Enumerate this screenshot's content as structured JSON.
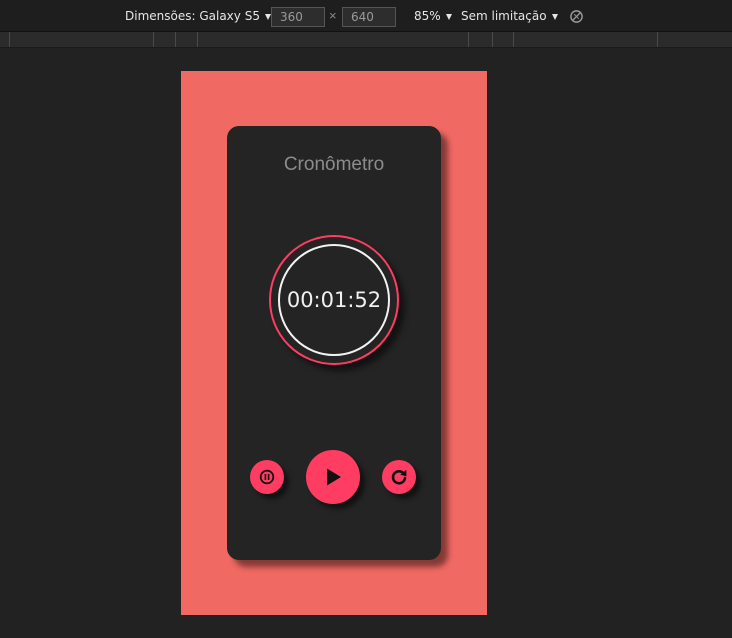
{
  "toolbar": {
    "dimensions_label": "Dimensões: Galaxy S5",
    "width_value": "360",
    "height_value": "640",
    "times_symbol": "×",
    "zoom": "85%",
    "throttle": "Sem limitação",
    "rotate_icon": "rotate-disabled-icon"
  },
  "app": {
    "title": "Cronômetro",
    "time": "00:01:52",
    "controls": {
      "pause_icon": "pause-icon",
      "play_icon": "play-icon",
      "reset_icon": "reset-icon"
    }
  },
  "colors": {
    "page_bg": "#f06962",
    "card_bg": "#242424",
    "accent": "#ff3d63",
    "ring_inner": "#f2f2f2",
    "devtools_bg": "#222222"
  }
}
